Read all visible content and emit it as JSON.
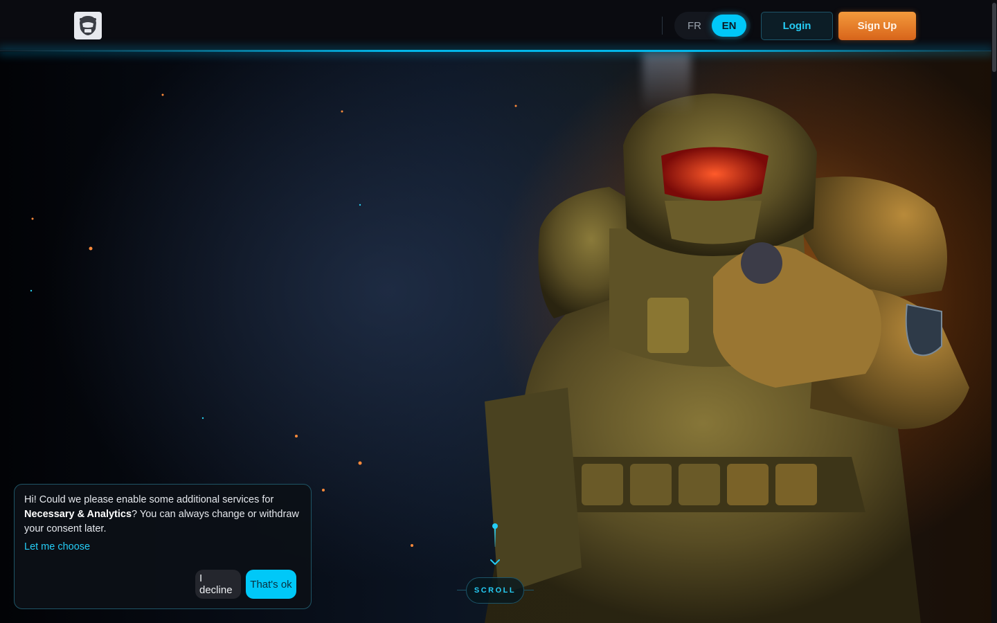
{
  "header": {
    "logo_icon": "robot-helmet-logo-icon",
    "languages": [
      {
        "code": "FR",
        "active": false
      },
      {
        "code": "EN",
        "active": true
      }
    ],
    "login_label": "Login",
    "signup_label": "Sign Up"
  },
  "hero": {
    "illustration": "armored-space-marine-pointing",
    "scroll_label": "SCROLL"
  },
  "cookie": {
    "text_before": "Hi! Could we please enable some additional services for ",
    "text_bold": "Necessary & Analytics",
    "text_after": "? You can always change or withdraw your consent later.",
    "choose_link": "Let me choose",
    "decline_label": "I decline",
    "accept_label": "That's ok"
  },
  "colors": {
    "accent_cyan": "#00c8f8",
    "accent_orange": "#e8782a",
    "background": "#05070b"
  }
}
